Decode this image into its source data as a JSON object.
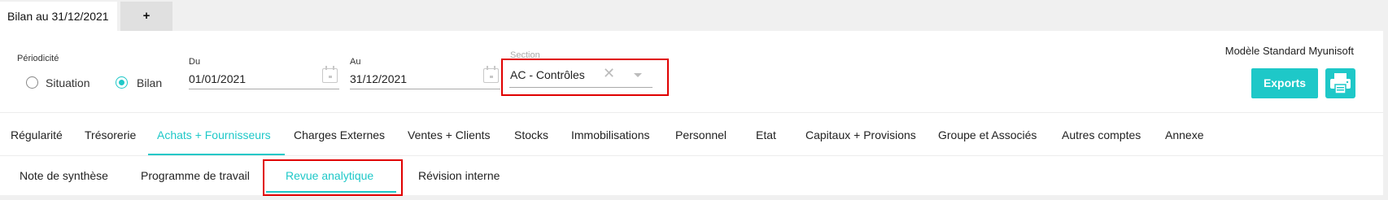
{
  "top_tabs": {
    "document_tab": "Bilan au 31/12/2021",
    "add_tab": "+"
  },
  "filters": {
    "periodicity_label": "Périodicité",
    "periodicity_options": [
      {
        "label": "Situation",
        "selected": false
      },
      {
        "label": "Bilan",
        "selected": true
      }
    ],
    "from_label": "Du",
    "from_value": "01/01/2021",
    "to_label": "Au",
    "to_value": "31/12/2021",
    "section_label": "Section",
    "section_value": "AC - Contrôles",
    "section_clear": "✕"
  },
  "actions": {
    "model_name": "Modèle Standard Myunisoft",
    "exports_label": "Exports"
  },
  "main_tabs": [
    {
      "label": "Régularité",
      "active": false
    },
    {
      "label": "Trésorerie",
      "active": false
    },
    {
      "label": "Achats + Fournisseurs",
      "active": true
    },
    {
      "label": "Charges Externes",
      "active": false
    },
    {
      "label": "Ventes + Clients",
      "active": false
    },
    {
      "label": "Stocks",
      "active": false
    },
    {
      "label": "Immobilisations",
      "active": false
    },
    {
      "label": "Personnel",
      "active": false
    },
    {
      "label": "Etat",
      "active": false
    },
    {
      "label": "Capitaux + Provisions",
      "active": false
    },
    {
      "label": "Groupe et Associés",
      "active": false
    },
    {
      "label": "Autres comptes",
      "active": false
    },
    {
      "label": "Annexe",
      "active": false
    }
  ],
  "sub_tabs": [
    {
      "label": "Note de synthèse",
      "active": false
    },
    {
      "label": "Programme de travail",
      "active": false
    },
    {
      "label": "Revue analytique",
      "active": true
    },
    {
      "label": "Révision interne",
      "active": false
    }
  ],
  "colors": {
    "accent": "#1ec8c8",
    "highlight_box": "#e00000"
  }
}
